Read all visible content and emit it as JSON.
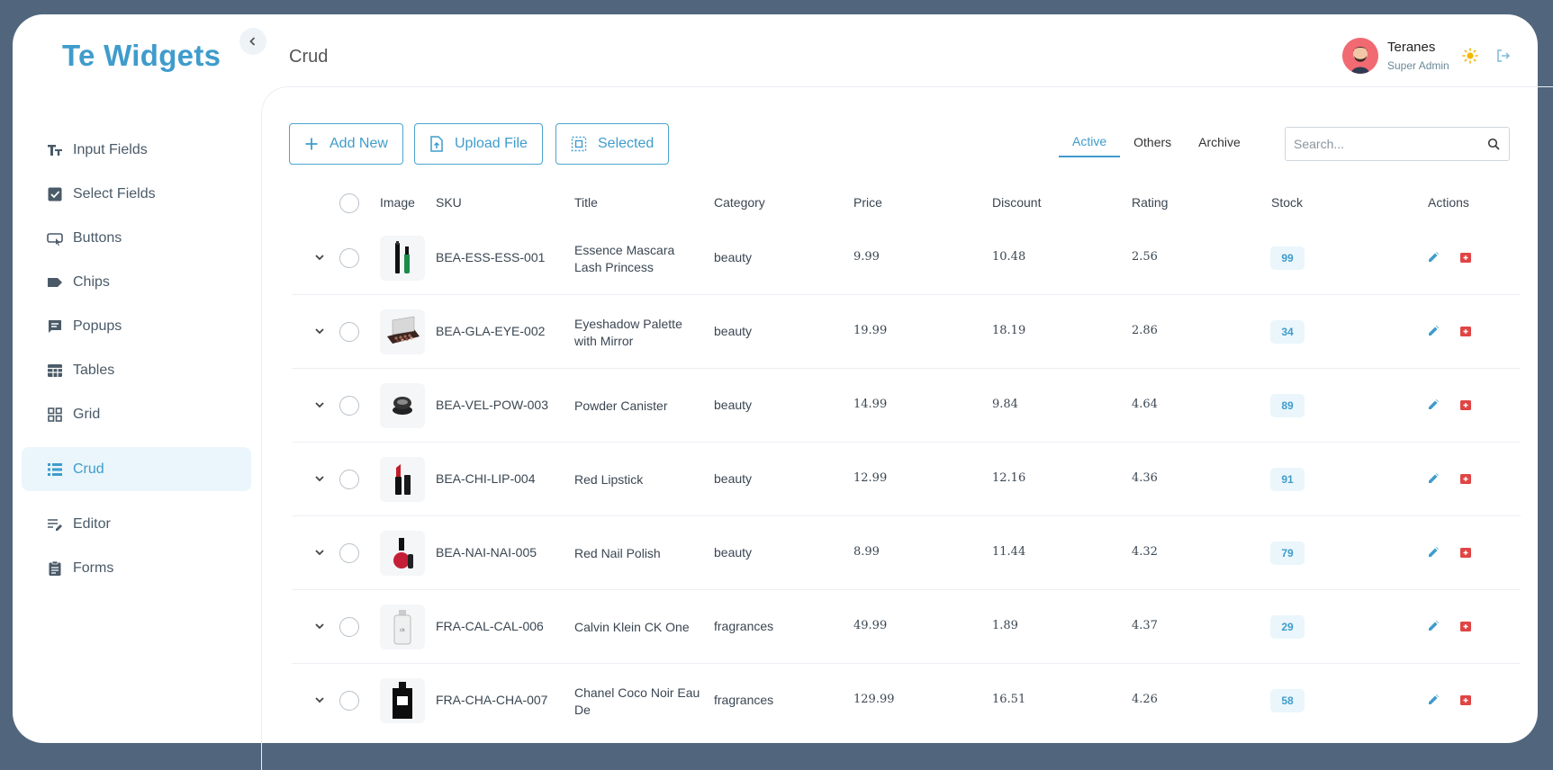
{
  "brand": {
    "name": "Te Widgets"
  },
  "breadcrumb": {
    "current": "Crud"
  },
  "user": {
    "name": "Teranes",
    "role": "Super Admin"
  },
  "sidebar": {
    "items": [
      {
        "label": "Input Fields",
        "icon": "text-format-icon"
      },
      {
        "label": "Select Fields",
        "icon": "checkbox-icon"
      },
      {
        "label": "Buttons",
        "icon": "button-icon"
      },
      {
        "label": "Chips",
        "icon": "label-icon"
      },
      {
        "label": "Popups",
        "icon": "chat-icon"
      },
      {
        "label": "Tables",
        "icon": "table-icon"
      },
      {
        "label": "Grid",
        "icon": "grid-icon"
      },
      {
        "label": "Crud",
        "icon": "list-icon",
        "active": true
      },
      {
        "label": "Editor",
        "icon": "edit-note-icon"
      },
      {
        "label": "Forms",
        "icon": "clipboard-icon"
      }
    ]
  },
  "toolbar": {
    "add_label": "Add New",
    "upload_label": "Upload File",
    "selected_label": "Selected"
  },
  "tabs": [
    {
      "label": "Active",
      "active": true
    },
    {
      "label": "Others"
    },
    {
      "label": "Archive"
    }
  ],
  "search": {
    "placeholder": "Search...",
    "value": ""
  },
  "table": {
    "headers": {
      "image": "Image",
      "sku": "SKU",
      "title": "Title",
      "category": "Category",
      "price": "Price",
      "discount": "Discount",
      "rating": "Rating",
      "stock": "Stock",
      "actions": "Actions"
    },
    "rows": [
      {
        "sku": "BEA-ESS-ESS-001",
        "title": "Essence Mascara Lash Princess",
        "category": "beauty",
        "price": "9.99",
        "discount": "10.48",
        "rating": "2.56",
        "stock": "99",
        "image": "mascara"
      },
      {
        "sku": "BEA-GLA-EYE-002",
        "title": "Eyeshadow Palette with Mirror",
        "category": "beauty",
        "price": "19.99",
        "discount": "18.19",
        "rating": "2.86",
        "stock": "34",
        "image": "palette"
      },
      {
        "sku": "BEA-VEL-POW-003",
        "title": "Powder Canister",
        "category": "beauty",
        "price": "14.99",
        "discount": "9.84",
        "rating": "4.64",
        "stock": "89",
        "image": "powder"
      },
      {
        "sku": "BEA-CHI-LIP-004",
        "title": "Red Lipstick",
        "category": "beauty",
        "price": "12.99",
        "discount": "12.16",
        "rating": "4.36",
        "stock": "91",
        "image": "lipstick"
      },
      {
        "sku": "BEA-NAI-NAI-005",
        "title": "Red Nail Polish",
        "category": "beauty",
        "price": "8.99",
        "discount": "11.44",
        "rating": "4.32",
        "stock": "79",
        "image": "nailpolish"
      },
      {
        "sku": "FRA-CAL-CAL-006",
        "title": "Calvin Klein CK One",
        "category": "fragrances",
        "price": "49.99",
        "discount": "1.89",
        "rating": "4.37",
        "stock": "29",
        "image": "ckone"
      },
      {
        "sku": "FRA-CHA-CHA-007",
        "title": "Chanel Coco Noir Eau De",
        "category": "fragrances",
        "price": "129.99",
        "discount": "16.51",
        "rating": "4.26",
        "stock": "58",
        "image": "chanel"
      }
    ]
  },
  "colors": {
    "accent": "#3f9ccc",
    "danger": "#e04545",
    "background": "#51667d"
  }
}
